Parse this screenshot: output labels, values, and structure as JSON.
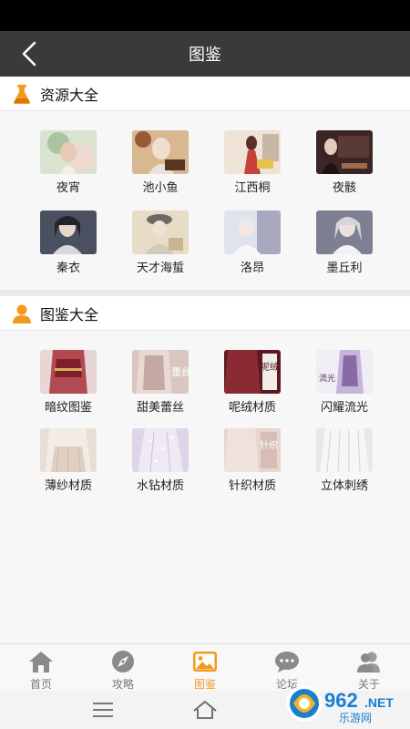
{
  "header": {
    "title": "图鉴"
  },
  "sections": {
    "resources": {
      "title": "资源大全",
      "items": [
        {
          "label": "夜宵"
        },
        {
          "label": "池小鱼"
        },
        {
          "label": "江西桐"
        },
        {
          "label": "夜骸"
        },
        {
          "label": "秦衣"
        },
        {
          "label": "天才海蜇"
        },
        {
          "label": "洛昂"
        },
        {
          "label": "墨丘利"
        }
      ]
    },
    "catalog": {
      "title": "图鉴大全",
      "items": [
        {
          "label": "暗纹图鉴"
        },
        {
          "label": "甜美蕾丝",
          "overlay": "蕾丝"
        },
        {
          "label": "呢绒材质",
          "overlay": "呢绒"
        },
        {
          "label": "闪耀流光",
          "overlay": "流光"
        },
        {
          "label": "薄纱材质"
        },
        {
          "label": "水钻材质"
        },
        {
          "label": "针织材质",
          "overlay": "针织"
        },
        {
          "label": "立体刺绣"
        }
      ]
    }
  },
  "tabbar": {
    "items": [
      {
        "label": "首页",
        "icon": "home-icon"
      },
      {
        "label": "攻略",
        "icon": "compass-icon"
      },
      {
        "label": "图鉴",
        "icon": "image-icon",
        "active": true
      },
      {
        "label": "论坛",
        "icon": "chat-icon"
      },
      {
        "label": "关于",
        "icon": "users-icon"
      }
    ]
  },
  "watermark": {
    "main": "962",
    "suffix": ".NET",
    "sub": "乐游网"
  },
  "colors": {
    "accent": "#f39a1e",
    "navbar": "#3a3a3a",
    "inactive": "#888888"
  }
}
